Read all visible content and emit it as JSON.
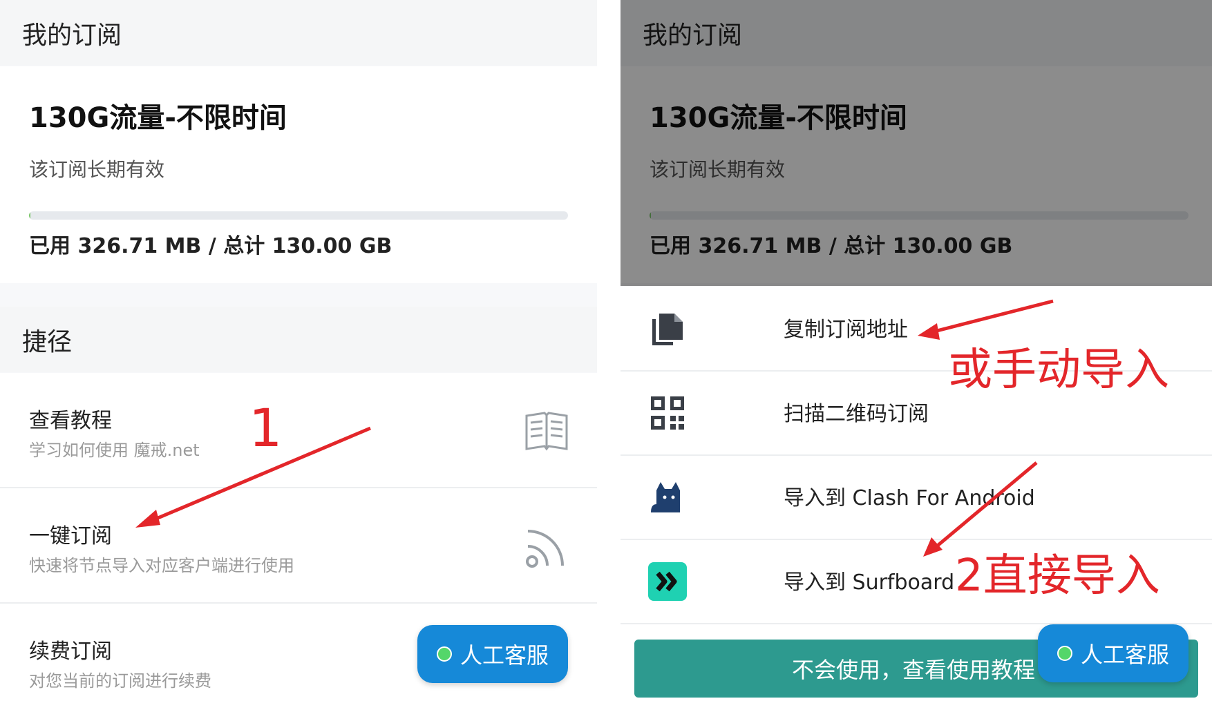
{
  "left": {
    "section_title": "我的订阅",
    "plan": {
      "title": "130G流量-不限时间",
      "desc": "该订阅长期有效",
      "usage": "已用 326.71 MB / 总计 130.00 GB",
      "progress_fraction": 0.0025
    },
    "shortcuts_title": "捷径",
    "items": [
      {
        "title": "查看教程",
        "sub": "学习如何使用 魔戒.net",
        "icon": "book-icon"
      },
      {
        "title": "一键订阅",
        "sub": "快速将节点导入对应客户端进行使用",
        "icon": "rss-icon"
      },
      {
        "title": "续费订阅",
        "sub": "对您当前的订阅进行续费"
      }
    ],
    "cs_button": "人工客服",
    "annotation": "1"
  },
  "right": {
    "section_title": "我的订阅",
    "plan": {
      "title": "130G流量-不限时间",
      "desc": "该订阅长期有效",
      "usage": "已用 326.71 MB / 总计 130.00 GB"
    },
    "sheet_items": [
      {
        "label": "复制订阅地址",
        "icon": "copy-icon"
      },
      {
        "label": "扫描二维码订阅",
        "icon": "qr-code-icon"
      },
      {
        "label": "导入到 Clash For Android",
        "icon": "clash-cat-icon"
      },
      {
        "label": "导入到 Surfboard",
        "icon": "surfboard-icon"
      }
    ],
    "tutorial_button": "不会使用，查看使用教程",
    "cs_button": "人工客服",
    "annotation_manual": "或手动导入",
    "annotation_direct": "2直接导入"
  },
  "colors": {
    "accent_blue": "#1689d8",
    "teal": "#2d9a8f",
    "annotation_red": "#e3262a",
    "progress_green": "#7cc66a"
  }
}
